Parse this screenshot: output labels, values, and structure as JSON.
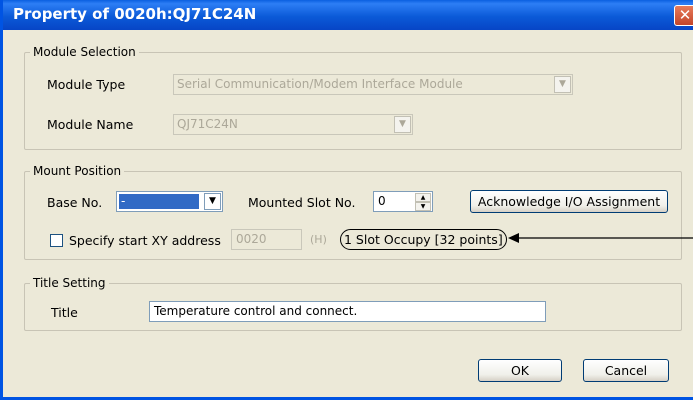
{
  "dialog": {
    "title": "Property of 0020h:QJ71C24N",
    "close_glyph": "✕"
  },
  "module_selection": {
    "legend": "Module Selection",
    "type_label": "Module Type",
    "type_value": "Serial Communication/Modem Interface Module",
    "name_label": "Module Name",
    "name_value": "QJ71C24N"
  },
  "mount_position": {
    "legend": "Mount Position",
    "base_label": "Base No.",
    "base_value": "-",
    "slot_label": "Mounted Slot No.",
    "slot_value": "0",
    "acknowledge_label": "Acknowledge I/O Assignment",
    "specify_label": "Specify start XY address",
    "specify_checked": false,
    "xy_address": "0020",
    "hex_unit": "(H)",
    "occupy_text": "1 Slot Occupy [32 points]"
  },
  "title_setting": {
    "legend": "Title Setting",
    "title_label": "Title",
    "title_value": "Temperature control and connect."
  },
  "footer": {
    "ok_label": "OK",
    "cancel_label": "Cancel"
  },
  "icons": {
    "dropdown": "▼",
    "spin_up": "▲",
    "spin_down": "▼"
  }
}
